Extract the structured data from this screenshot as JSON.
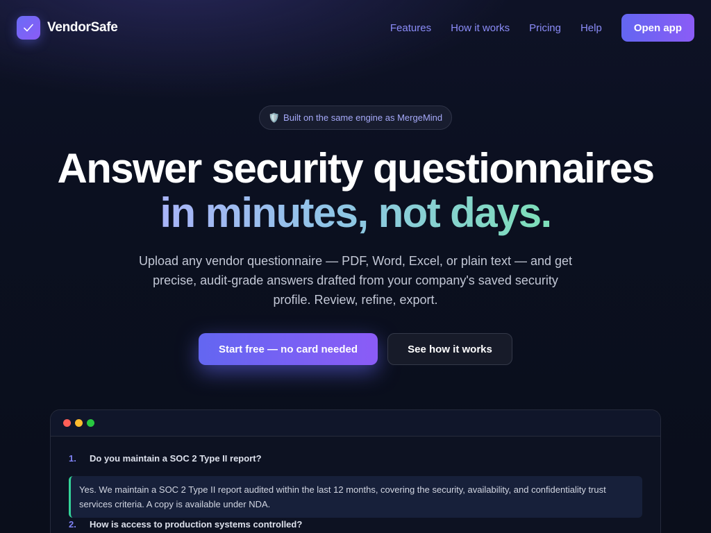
{
  "brand": {
    "name": "VendorSafe",
    "logo_icon": "check-mark-icon",
    "logo_glyph": "√"
  },
  "nav": {
    "links": [
      "Features",
      "How it works",
      "Pricing",
      "Help"
    ],
    "open_app_label": "Open app"
  },
  "hero": {
    "badge_icon": "🛡️",
    "badge_text": "Built on the same engine as MergeMind",
    "headline_line1": "Answer security questionnaires",
    "headline_line2": "in minutes, not days.",
    "subtext": "Upload any vendor questionnaire — PDF, Word, Excel, or plain text — and get precise, audit-grade answers drafted from your company's saved security profile. Review, refine, export.",
    "cta_primary": "Start free — no card needed",
    "cta_secondary": "See how it works"
  },
  "preview": {
    "window_dots": [
      "#ff5f57",
      "#febc2e",
      "#28c840"
    ],
    "questions": [
      {
        "number": "1.",
        "question": "Do you maintain a SOC 2 Type II report?",
        "answer": "Yes. We maintain a SOC 2 Type II report audited within the last 12 months, covering the security, availability, and confidentiality trust services criteria. A copy is available under NDA."
      },
      {
        "number": "2.",
        "question": "How is access to production systems controlled?"
      }
    ]
  },
  "colors": {
    "accent": "#6366f1",
    "accent_2": "#8b5cf6",
    "answer_border": "#34d399",
    "nav_link": "#8b8cf8"
  }
}
